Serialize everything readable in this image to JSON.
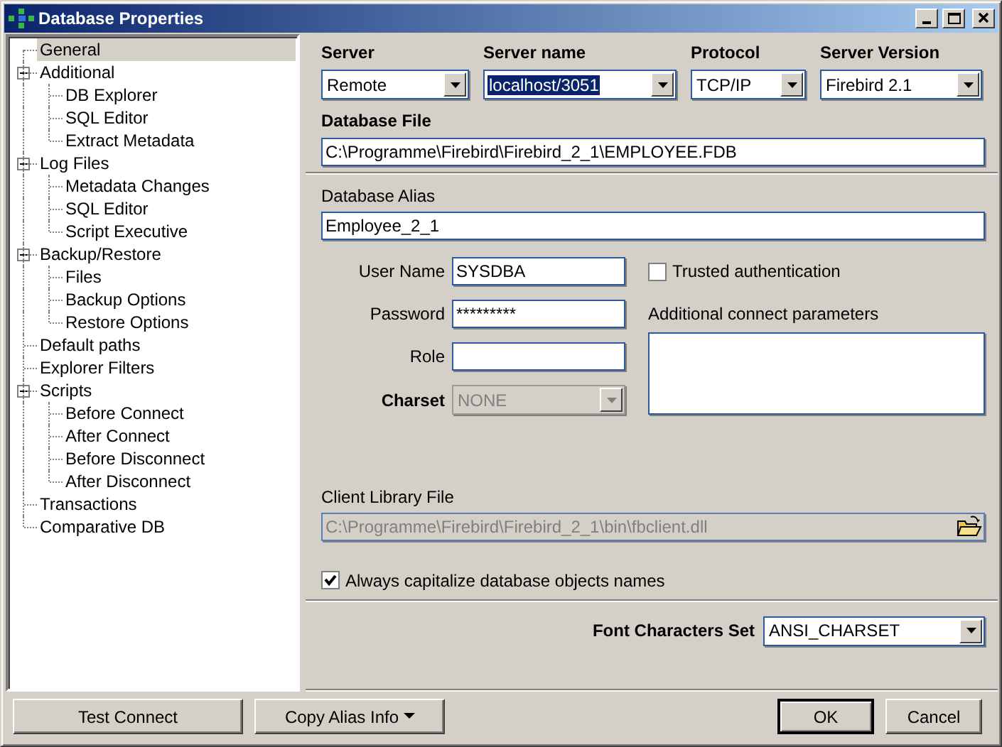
{
  "window": {
    "title": "Database Properties"
  },
  "tree": [
    {
      "label": "General",
      "selected": true
    },
    {
      "label": "Additional",
      "selected": false,
      "expanded": true,
      "children": [
        {
          "label": "DB Explorer",
          "selected": false
        },
        {
          "label": "SQL Editor",
          "selected": false
        },
        {
          "label": "Extract Metadata",
          "selected": false
        }
      ]
    },
    {
      "label": "Log Files",
      "selected": false,
      "expanded": true,
      "children": [
        {
          "label": "Metadata Changes",
          "selected": false
        },
        {
          "label": "SQL Editor",
          "selected": false
        },
        {
          "label": "Script Executive",
          "selected": false
        }
      ]
    },
    {
      "label": "Backup/Restore",
      "selected": false,
      "expanded": true,
      "children": [
        {
          "label": "Files",
          "selected": false
        },
        {
          "label": "Backup Options",
          "selected": false
        },
        {
          "label": "Restore Options",
          "selected": false
        }
      ]
    },
    {
      "label": "Default paths",
      "selected": false
    },
    {
      "label": "Explorer Filters",
      "selected": false
    },
    {
      "label": "Scripts",
      "selected": false,
      "expanded": true,
      "children": [
        {
          "label": "Before Connect",
          "selected": false
        },
        {
          "label": "After Connect",
          "selected": false
        },
        {
          "label": "Before Disconnect",
          "selected": false
        },
        {
          "label": "After Disconnect",
          "selected": false
        }
      ]
    },
    {
      "label": "Transactions",
      "selected": false
    },
    {
      "label": "Comparative DB",
      "selected": false
    }
  ],
  "server_fields": [
    {
      "label": "Server",
      "value": "Remote",
      "highlighted": false
    },
    {
      "label": "Server name",
      "value": "localhost/3051",
      "highlighted": true
    },
    {
      "label": "Protocol",
      "value": "TCP/IP",
      "highlighted": false
    },
    {
      "label": "Server Version",
      "value": "Firebird 2.1",
      "highlighted": false
    }
  ],
  "database_file": {
    "label": "Database File",
    "value": "C:\\Programme\\Firebird\\Firebird_2_1\\EMPLOYEE.FDB"
  },
  "alias": {
    "label": "Database Alias",
    "value": "Employee_2_1"
  },
  "login_fields": [
    {
      "label": "User Name",
      "value": "SYSDBA",
      "kind": "text",
      "bold": false,
      "disabled": false
    },
    {
      "label": "Password",
      "value": "*********",
      "kind": "text",
      "bold": false,
      "disabled": false
    },
    {
      "label": "Role",
      "kind": "text",
      "bold": false,
      "disabled": false
    },
    {
      "label": "Charset",
      "value": "NONE",
      "kind": "combo",
      "bold": true,
      "disabled": true
    }
  ],
  "trusted_authentication": {
    "label": "Trusted authentication",
    "checked": false
  },
  "additional_parameters": {
    "label": "Additional connect parameters"
  },
  "client_library": {
    "label": "Client Library File",
    "value": "C:\\Programme\\Firebird\\Firebird_2_1\\bin\\fbclient.dll",
    "disabled": true
  },
  "capitalize": {
    "label": "Always capitalize database objects names",
    "checked": true
  },
  "font_charset": {
    "label": "Font Characters Set",
    "value": "ANSI_CHARSET"
  },
  "buttons": [
    {
      "label": "Test Connect",
      "kind": "plain"
    },
    {
      "label": "Copy Alias Info",
      "kind": "menu"
    },
    {
      "label": "OK",
      "kind": "default"
    },
    {
      "label": "Cancel",
      "kind": "plain"
    }
  ]
}
